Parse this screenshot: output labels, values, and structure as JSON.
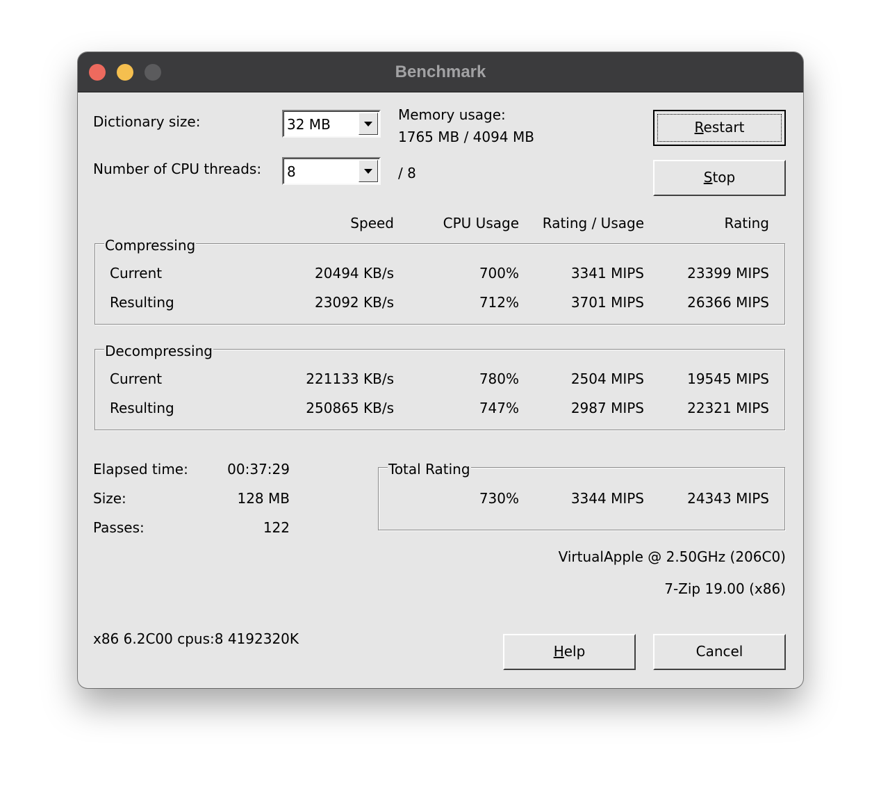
{
  "window": {
    "title": "Benchmark"
  },
  "settings": {
    "dict_label": "Dictionary size:",
    "dict_value": "32 MB",
    "threads_label": "Number of CPU threads:",
    "threads_value": "8",
    "threads_total": "/ 8",
    "memory_label": "Memory usage:",
    "memory_value": "1765 MB / 4094 MB"
  },
  "buttons": {
    "restart": {
      "hotkey": "R",
      "rest": "estart"
    },
    "stop": {
      "hotkey": "S",
      "rest": "top"
    },
    "help": {
      "hotkey": "H",
      "rest": "elp"
    },
    "cancel": "Cancel"
  },
  "headers": {
    "speed": "Speed",
    "cpu": "CPU Usage",
    "rating_usage": "Rating / Usage",
    "rating": "Rating"
  },
  "compressing": {
    "title": "Compressing",
    "rows": [
      {
        "label": "Current",
        "speed": "20494 KB/s",
        "cpu": "700%",
        "rating_usage": "3341 MIPS",
        "rating": "23399 MIPS"
      },
      {
        "label": "Resulting",
        "speed": "23092 KB/s",
        "cpu": "712%",
        "rating_usage": "3701 MIPS",
        "rating": "26366 MIPS"
      }
    ]
  },
  "decompressing": {
    "title": "Decompressing",
    "rows": [
      {
        "label": "Current",
        "speed": "221133 KB/s",
        "cpu": "780%",
        "rating_usage": "2504 MIPS",
        "rating": "19545 MIPS"
      },
      {
        "label": "Resulting",
        "speed": "250865 KB/s",
        "cpu": "747%",
        "rating_usage": "2987 MIPS",
        "rating": "22321 MIPS"
      }
    ]
  },
  "stats": {
    "elapsed_label": "Elapsed time:",
    "elapsed_value": "00:37:29",
    "size_label": "Size:",
    "size_value": "128 MB",
    "passes_label": "Passes:",
    "passes_value": "122"
  },
  "total": {
    "title": "Total Rating",
    "cpu": "730%",
    "rating_usage": "3344 MIPS",
    "rating": "24343 MIPS"
  },
  "system": {
    "cpu_info": "VirtualApple @ 2.50GHz (206C0)",
    "version": "7-Zip 19.00 (x86)",
    "sys_info": "x86 6.2C00 cpus:8 4192320K"
  }
}
